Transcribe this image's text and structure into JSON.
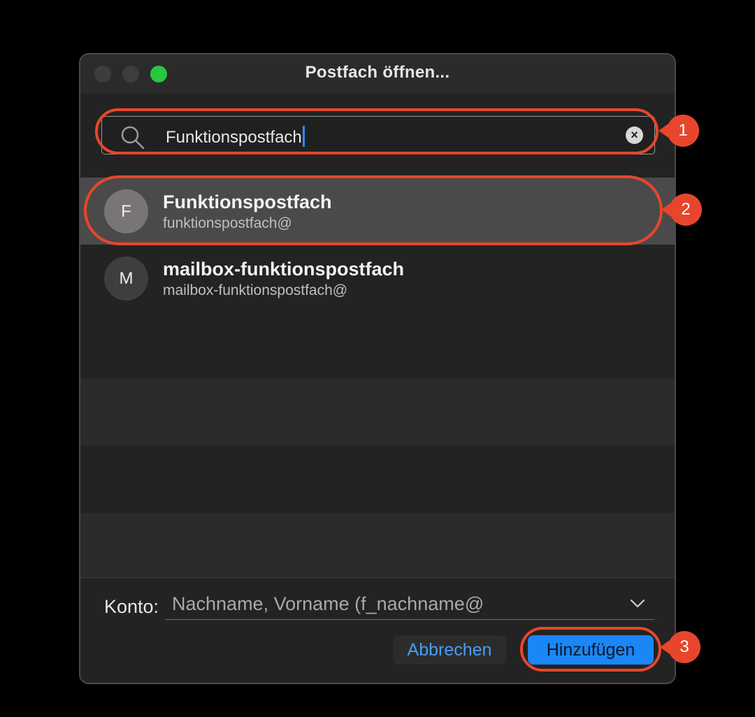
{
  "window": {
    "title": "Postfach öffnen..."
  },
  "search": {
    "value": "Funktionspostfach",
    "clear_label": "×"
  },
  "results": [
    {
      "initial": "F",
      "name": "Funktionspostfach",
      "email": "funktionspostfach@",
      "selected": true
    },
    {
      "initial": "M",
      "name": "mailbox-funktionspostfach",
      "email": "mailbox-funktionspostfach@",
      "selected": false
    }
  ],
  "footer": {
    "konto_label": "Konto:",
    "konto_value": "Nachname, Vorname (f_nachname@",
    "cancel_label": "Abbrechen",
    "add_label": "Hinzufügen"
  },
  "annotations": {
    "one": "1",
    "two": "2",
    "three": "3",
    "color": "#e8462c"
  },
  "colors": {
    "accent": "#1b86f5",
    "zoom": "#28c840",
    "caret": "#2f8cff"
  }
}
